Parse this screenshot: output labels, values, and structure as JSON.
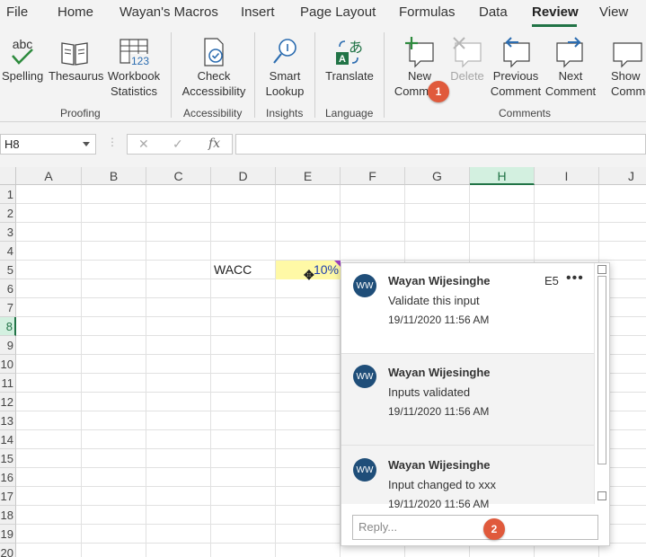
{
  "tabs": [
    "File",
    "Home",
    "Wayan's Macros",
    "Insert",
    "Page Layout",
    "Formulas",
    "Data",
    "Review",
    "View"
  ],
  "active_tab": "Review",
  "ribbon": {
    "spelling": "Spelling",
    "thesaurus": "Thesaurus",
    "workbook_stats_1": "Workbook",
    "workbook_stats_2": "Statistics",
    "check_acc_1": "Check",
    "check_acc_2": "Accessibility",
    "smart_lookup_1": "Smart",
    "smart_lookup_2": "Lookup",
    "translate": "Translate",
    "new_comment_1": "New",
    "new_comment_2": "Comment",
    "delete": "Delete",
    "prev_comment_1": "Previous",
    "prev_comment_2": "Comment",
    "next_comment_1": "Next",
    "next_comment_2": "Comment",
    "show_comments_1": "Show",
    "show_comments_2": "Comments",
    "groups": {
      "proofing": "Proofing",
      "accessibility": "Accessibility",
      "insights": "Insights",
      "language": "Language",
      "comments": "Comments"
    },
    "abc_text": "abc",
    "stats_num": "123",
    "badge_1": "1",
    "badge_2": "2"
  },
  "formula_bar": {
    "name_box": "H8",
    "cancel": "✕",
    "enter": "✓",
    "fx": "fx",
    "value": ""
  },
  "columns": [
    "A",
    "B",
    "C",
    "D",
    "E",
    "F",
    "G",
    "H",
    "I",
    "J"
  ],
  "selected_column": "H",
  "rows": [
    "1",
    "2",
    "3",
    "4",
    "5",
    "6",
    "7",
    "8",
    "9",
    "10",
    "11",
    "12",
    "13",
    "14",
    "15",
    "16",
    "17",
    "18",
    "19",
    "20"
  ],
  "selected_row": "8",
  "cells": {
    "d5": "WACC",
    "e5": "10%"
  },
  "comments_pane": {
    "cell_ref": "E5",
    "more": "•••",
    "threads": [
      {
        "initials": "WW",
        "author": "Wayan Wijesinghe",
        "text": "Validate this input",
        "time": "19/11/2020 11:56 AM"
      },
      {
        "initials": "WW",
        "author": "Wayan Wijesinghe",
        "text": "Inputs validated",
        "time": "19/11/2020 11:56 AM"
      },
      {
        "initials": "WW",
        "author": "Wayan Wijesinghe",
        "text": "Input changed to xxx",
        "time": "19/11/2020 11:56 AM"
      }
    ],
    "reply_placeholder": "Reply..."
  },
  "colors": {
    "accent": "#217346",
    "badge": "#e05a3c",
    "avatar": "#1f4e79",
    "highlight": "#fff9a6",
    "comment_indicator": "#9b3fbf"
  }
}
